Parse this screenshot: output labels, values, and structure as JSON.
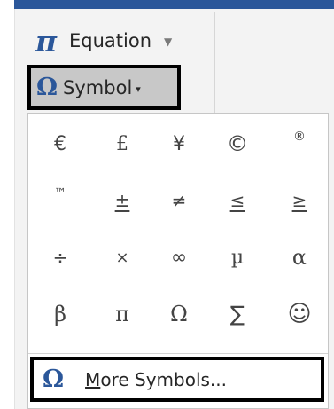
{
  "ribbon": {
    "equation": {
      "icon": "pi-icon",
      "glyph": "π",
      "label": "Equation",
      "caret": "▼"
    },
    "symbol": {
      "icon": "omega-icon",
      "glyph": "Ω",
      "label": "Symbol",
      "caret": "▾",
      "state": "pressed"
    }
  },
  "dropdown": {
    "symbols": [
      [
        "€",
        "£",
        "¥",
        "©",
        "®"
      ],
      [
        "™",
        "±",
        "≠",
        "≤",
        "≥"
      ],
      [
        "÷",
        "×",
        "∞",
        "µ",
        "α"
      ],
      [
        "β",
        "π",
        "Ω",
        "∑",
        "☺"
      ]
    ],
    "more": {
      "icon": "omega-icon",
      "glyph": "Ω",
      "underlined_letter": "M",
      "label_rest": "ore Symbols..."
    }
  },
  "colors": {
    "accent": "#2b579a",
    "highlight_border": "#000000",
    "pressed_background": "#c8c8c8"
  }
}
